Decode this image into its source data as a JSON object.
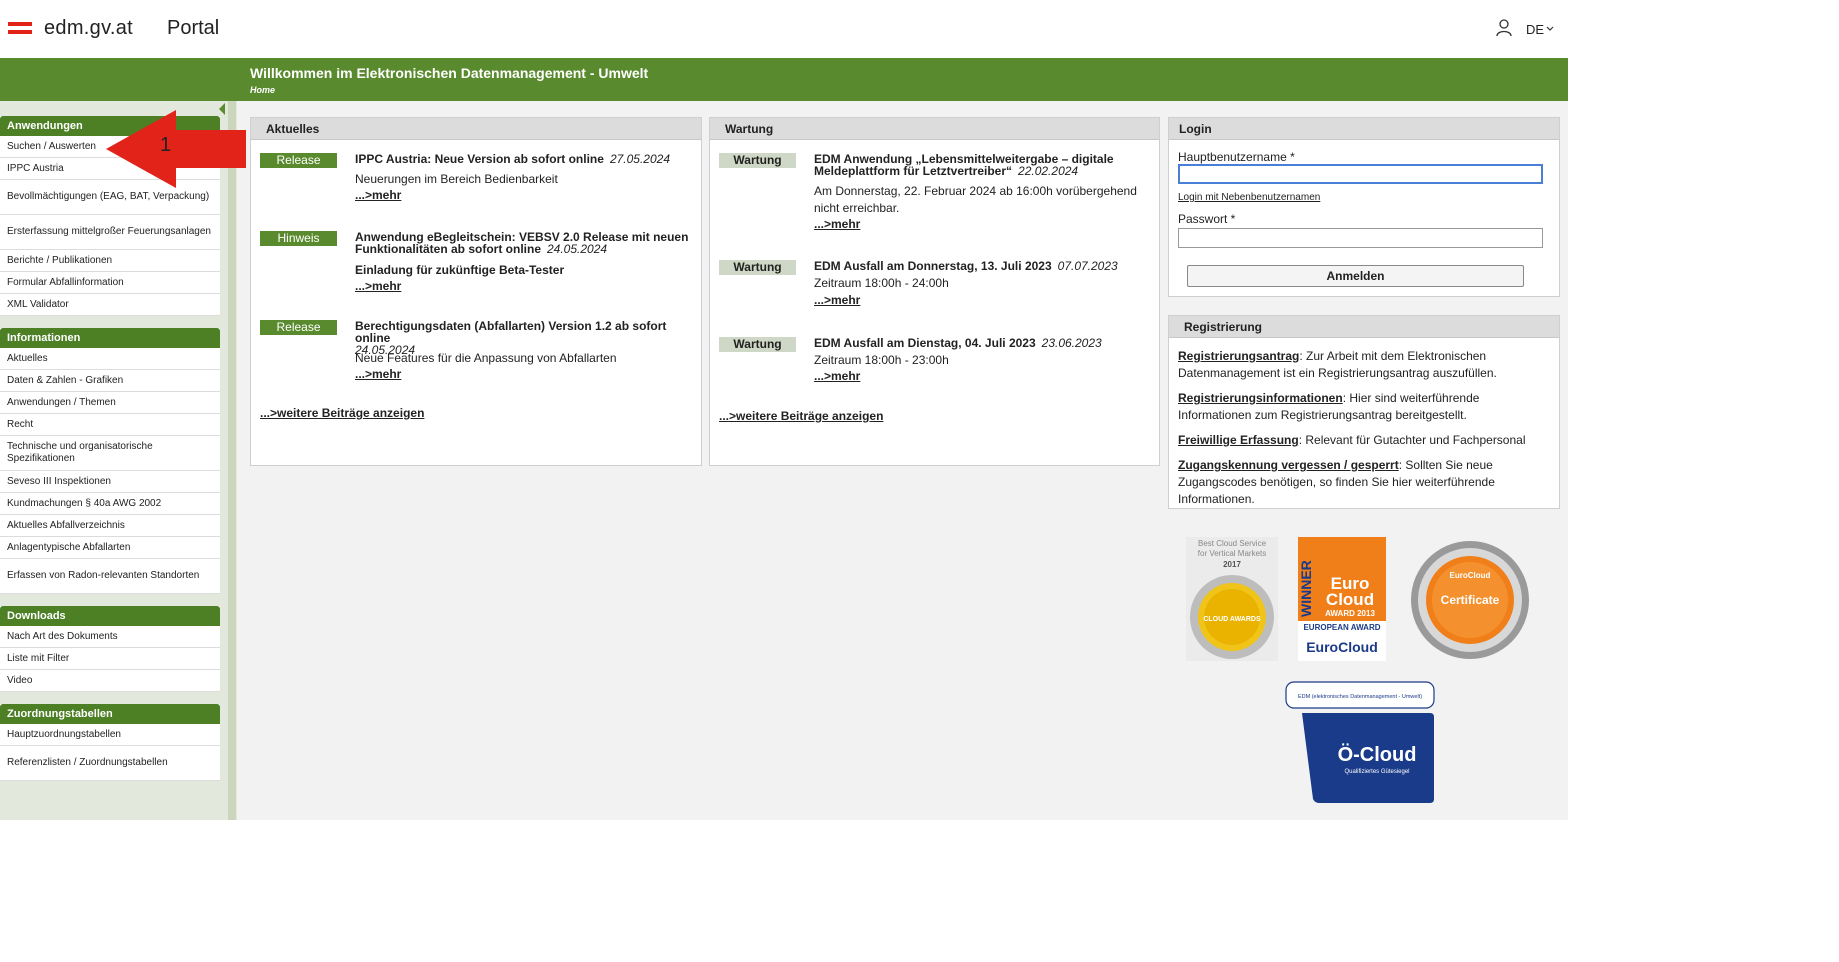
{
  "header": {
    "brand": "edm.gv.at",
    "portal": "Portal",
    "language": "DE"
  },
  "banner": {
    "title": "Willkommen im Elektronischen Datenmanagement - Umwelt",
    "breadcrumb": "Home"
  },
  "annotation": {
    "number": "1"
  },
  "sidebar": {
    "groups": [
      {
        "title": "Anwendungen",
        "items": [
          "Suchen / Auswerten",
          "IPPC Austria",
          "Bevollmächtigungen (EAG, BAT, Verpackung)",
          "Ersterfassung mittelgroßer Feuerungsanlagen",
          "Berichte / Publikationen",
          "Formular Abfallinformation",
          "XML Validator"
        ]
      },
      {
        "title": "Informationen",
        "items": [
          "Aktuelles",
          "Daten & Zahlen - Grafiken",
          "Anwendungen / Themen",
          "Recht",
          "Technische und organisatorische Spezifikationen",
          "Seveso III Inspektionen",
          "Kundmachungen § 40a AWG 2002",
          "Aktuelles Abfallverzeichnis",
          "Anlagentypische Abfallarten",
          "Erfassen von Radon-relevanten Standorten"
        ]
      },
      {
        "title": "Downloads",
        "items": [
          "Nach Art des Dokuments",
          "Liste mit Filter",
          "Video"
        ]
      },
      {
        "title": "Zuordnungstabellen",
        "items": [
          "Hauptzuordnungstabellen",
          "Referenzlisten / Zuordnungstabellen"
        ]
      }
    ]
  },
  "aktuelles": {
    "title": "Aktuelles",
    "entries": [
      {
        "tag": "Release",
        "title": "IPPC Austria: Neue Version ab sofort online",
        "date": "27.05.2024",
        "text": "Neuerungen im Bereich Bedienbarkeit",
        "more": "...>mehr"
      },
      {
        "tag": "Hinweis",
        "title": "Anwendung eBegleitschein: VEBSV 2.0 Release mit neuen Funktionalitäten ab sofort online",
        "date": "24.05.2024",
        "text": "Einladung für zukünftige Beta-Tester",
        "more": "...>mehr"
      },
      {
        "tag": "Release",
        "title": "Berechtigungsdaten (Abfallarten) Version 1.2 ab sofort online",
        "date": "24.05.2024",
        "text": "Neue Features für die Anpassung von Abfallarten",
        "more": "...>mehr"
      }
    ],
    "all": "...>weitere Beiträge anzeigen"
  },
  "wartung": {
    "title": "Wartung",
    "entries": [
      {
        "tag": "Wartung",
        "title": "EDM Anwendung „Lebensmittelweitergabe – digitale Meldeplattform für Letztvertreiber“",
        "date": "22.02.2024",
        "text": "Am Donnerstag, 22. Februar 2024 ab 16:00h vorübergehend nicht erreichbar.",
        "more": "...>mehr"
      },
      {
        "tag": "Wartung",
        "title": "EDM Ausfall am Donnerstag, 13. Juli 2023",
        "date": "07.07.2023",
        "text": "Zeitraum 18:00h - 24:00h",
        "more": "...>mehr"
      },
      {
        "tag": "Wartung",
        "title": "EDM Ausfall am Dienstag, 04. Juli 2023",
        "date": "23.06.2023",
        "text": "Zeitraum 18:00h - 23:00h",
        "more": "...>mehr"
      }
    ],
    "all": "...>weitere Beiträge anzeigen"
  },
  "login": {
    "title": "Login",
    "user_label": "Hauptbenutzername *",
    "user_value": "",
    "sub_login": "Login mit Nebenbenutzernamen",
    "pass_label": "Passwort *",
    "pass_value": "",
    "submit": "Anmelden"
  },
  "register": {
    "title": "Registrierung",
    "items": [
      {
        "link": "Registrierungsantrag",
        "text": ": Zur Arbeit mit dem Elektronischen Datenmanagement ist ein Registrierungsantrag auszufüllen."
      },
      {
        "link": "Registrierungsinformationen",
        "text": ": Hier sind weiterführende Informationen zum Registrierungsantrag bereitgestellt."
      },
      {
        "link": "Freiwillige Erfassung",
        "text": ": Relevant für Gutachter und Fachpersonal"
      },
      {
        "link": "Zugangskennung vergessen / gesperrt",
        "text": ": Sollten Sie neue Zugangscodes benötigen, so finden Sie hier weiterführende Informationen."
      }
    ]
  },
  "badges": {
    "cloud_award": {
      "line1": "Best Cloud Service",
      "line2": "for Vertical Markets",
      "year": "2017",
      "label": "CLOUD AWARDS"
    },
    "eurocloud": {
      "winner": "WINNER",
      "euro": "Euro",
      "cloud": "Cloud",
      "award": "AWARD 2013",
      "european": "EUROPEAN AWARD",
      "brand": "EuroCloud"
    },
    "certificate": {
      "label": "Certificate",
      "logo": "EuroCloud"
    },
    "ocloud": {
      "caption": "EDM (elektronisches Datenmanagement - Umwelt)",
      "title": "Ö-Cloud",
      "subtitle": "Qualifiziertes Gütesiegel"
    }
  },
  "colors": {
    "green": "#5a8a2e",
    "nav_green": "#4d7f25",
    "red_arrow": "#e2231a"
  }
}
